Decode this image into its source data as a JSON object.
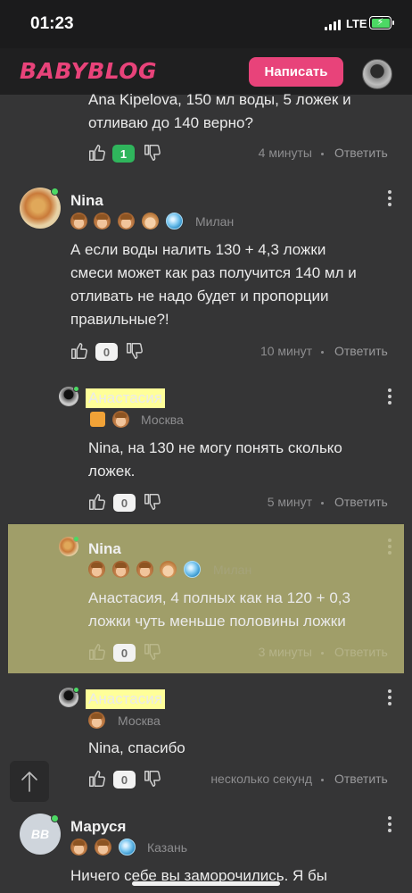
{
  "status": {
    "time": "01:23",
    "network": "LTE"
  },
  "header": {
    "logo": "BABYBLOG",
    "write_button": "Написать"
  },
  "comments": [
    {
      "text_lines": [
        "Ana Kipelova, 150 мл воды, 5 ложек и",
        "отливаю до 140 верно?"
      ],
      "votes": "1",
      "time": "4 минуты",
      "reply": "Ответить"
    },
    {
      "author": "Nina",
      "location": "Милан",
      "text_lines": [
        "А если воды налить 130 + 4,3 ложки",
        "смеси может как раз получится 140 мл и",
        "отливать не надо будет и пропорции",
        "правильные?!"
      ],
      "votes": "0",
      "time": "10 минут",
      "reply": "Ответить"
    },
    {
      "author": "Анастасия",
      "location": "Москва",
      "text_lines": [
        "Nina, на 130 не могу понять сколько",
        "ложек."
      ],
      "votes": "0",
      "time": "5 минут",
      "reply": "Ответить"
    },
    {
      "author": "Nina",
      "location": "Милан",
      "text_lines": [
        "Анастасия, 4 полных как на 120 + 0,3",
        "ложки чуть меньше половины ложки"
      ],
      "votes": "0",
      "time": "3 минуты",
      "reply": "Ответить"
    },
    {
      "author": "Анастасия",
      "location": "Москва",
      "text_lines": [
        "Nina, спасибо"
      ],
      "votes": "0",
      "time": "несколько секунд",
      "reply": "Ответить"
    },
    {
      "author": "Маруся",
      "avatar_initials": "BB",
      "location": "Казань",
      "text_lines": [
        "Ничего себе вы заморочились. Я бы"
      ]
    }
  ],
  "colors": {
    "brand": "#e8437a",
    "background": "#353536",
    "highlight": "#a09e69",
    "name_highlight": "#ffff99",
    "online": "#4cd964"
  }
}
